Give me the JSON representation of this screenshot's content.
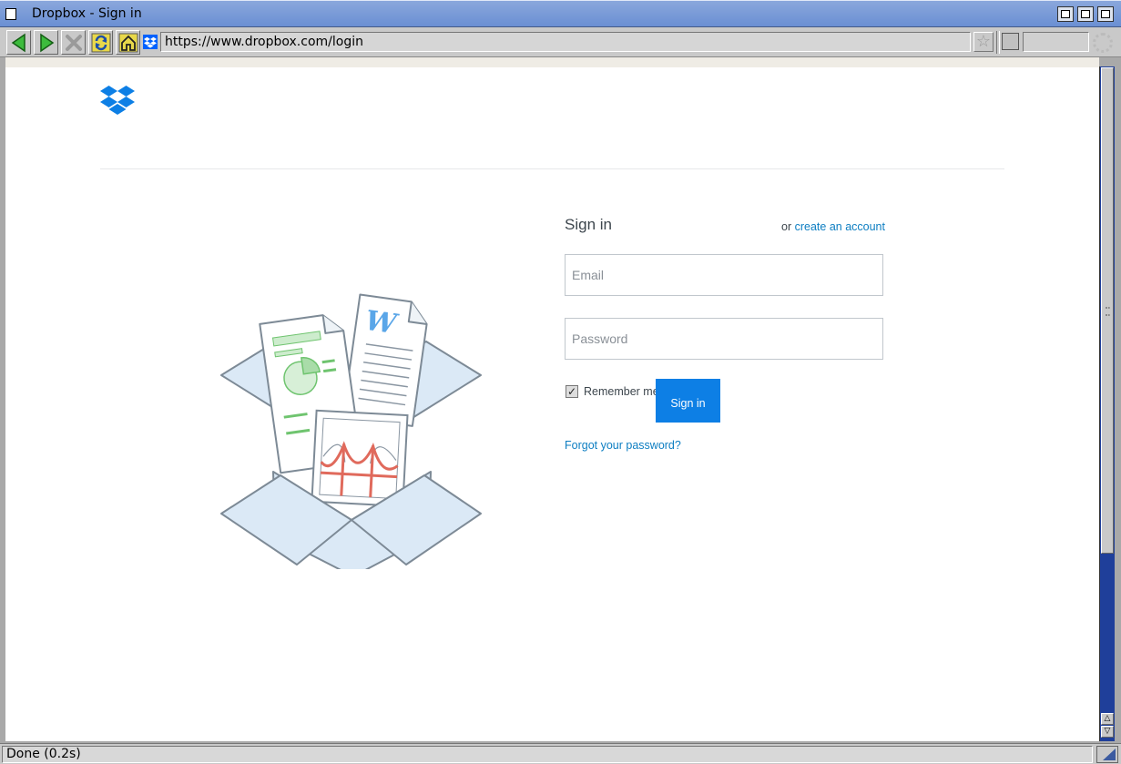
{
  "window": {
    "title": "Dropbox - Sign in"
  },
  "toolbar": {
    "url": "https://www.dropbox.com/login",
    "buttons": [
      "back-icon",
      "forward-icon",
      "stop-icon",
      "reload-icon",
      "home-icon"
    ]
  },
  "page": {
    "signin": {
      "heading": "Sign in",
      "or_text": "or",
      "create_account_link": "create an account",
      "email_placeholder": "Email",
      "password_placeholder": "Password",
      "remember_label": "Remember me",
      "remember_checked": true,
      "submit_label": "Sign in",
      "forgot_link": "Forgot your password?"
    },
    "colors": {
      "brand_blue": "#0d7fe5",
      "link_blue": "#0d7ec2"
    }
  },
  "status": {
    "text": "Done (0.2s)"
  }
}
